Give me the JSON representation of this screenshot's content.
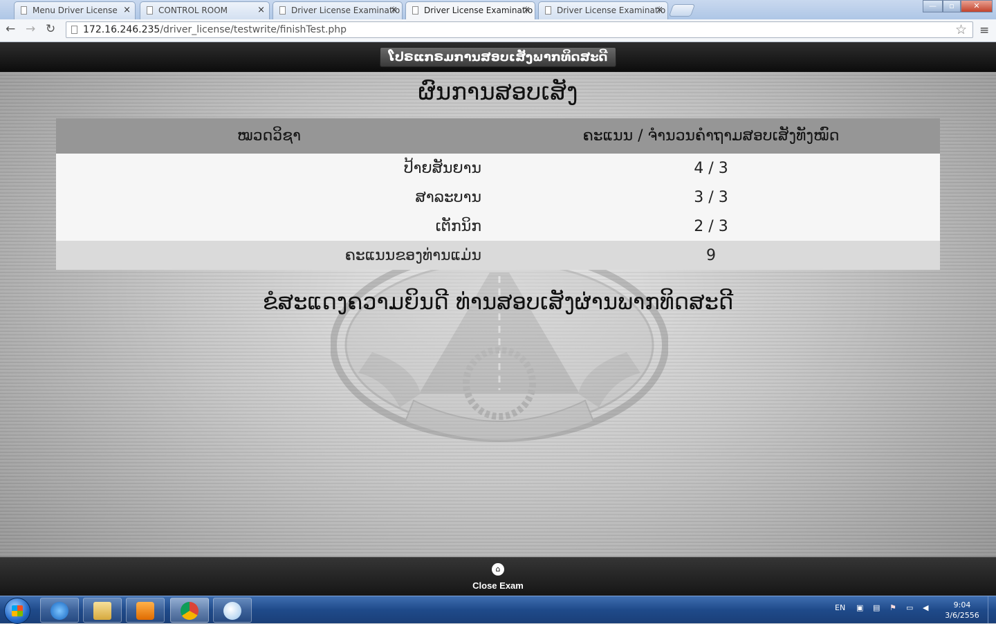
{
  "browser": {
    "tabs": [
      {
        "label": "Menu Driver License",
        "active": false
      },
      {
        "label": "CONTROL ROOM",
        "active": false
      },
      {
        "label": "Driver License Examinatio",
        "active": false
      },
      {
        "label": "Driver License Examinatio",
        "active": true
      },
      {
        "label": "Driver License Examinatio",
        "active": false
      }
    ],
    "close_glyph": "×",
    "url_host": "172.16.246.235",
    "url_path": "/driver_license/testwrite/finishTest.php"
  },
  "page": {
    "program_title": "ໂປຣແກຣມການສອບເສັງພາກທິດສະດີ",
    "result_title": "ຜົນການສອບເສັງ",
    "table": {
      "headers": [
        "ໝວດວິຊາ",
        "ຄະແນນ / ຈຳນວນຄຳຖາມສອບເສັງທັງໝົດ"
      ],
      "rows": [
        {
          "subject": "ປ້າຍສັນຍານ",
          "score": "4 / 3"
        },
        {
          "subject": "ສາລະບານ",
          "score": "3 / 3"
        },
        {
          "subject": "ເຕັກນິກ",
          "score": "2 / 3"
        }
      ],
      "total_label": "ຄະແນນຂອງທ່ານແມ່ນ",
      "total_value": "9"
    },
    "congrats": "ຂໍສະແດງຄວາມຍິນດີ ທ່ານສອບເສັງຜ່ານພາກທິດສະດີ",
    "close_exam_label": "Close Exam"
  },
  "taskbar": {
    "language": "EN",
    "time": "9:04",
    "date": "3/6/2556"
  },
  "colors": {
    "header_bar": "#0c0c0c",
    "table_header": "#969696",
    "table_row": "#f6f6f6",
    "total_row": "#dadada"
  }
}
